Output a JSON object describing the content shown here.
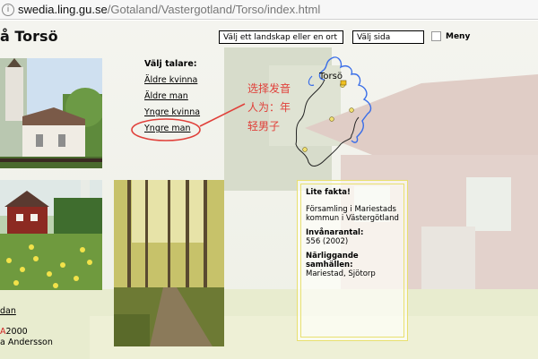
{
  "browser": {
    "host": "swedia.ling.gu.se",
    "path": "/Gotaland/Vastergotland/Torso/index.html"
  },
  "header": {
    "title": "å Torsö",
    "landskap_select": "Välj ett landskap eller en ort",
    "sida_select": "Välj sida",
    "meny_label": "Meny"
  },
  "talare": {
    "heading": "Välj talare:",
    "items": [
      "Äldre kvinna",
      "Äldre man",
      "Yngre kvinna",
      "Yngre man"
    ]
  },
  "annotation": {
    "lines": [
      "选择发音",
      "人为：年",
      "轻男子"
    ],
    "color": "#e0403a"
  },
  "map": {
    "label": "Torsö"
  },
  "fakta": {
    "heading": "Lite fakta!",
    "forsamling": "Församling i Mariestads kommun i Västergötland",
    "invanare_label": "Invånarantal:",
    "invanare_value": "556 (2002)",
    "narliggande_label": "Närliggande samhällen:",
    "narliggande_value": "Mariestad, Sjötorp"
  },
  "footer": {
    "link": "dan",
    "year_a": "A",
    "year": "2000",
    "name": "a Andersson"
  }
}
